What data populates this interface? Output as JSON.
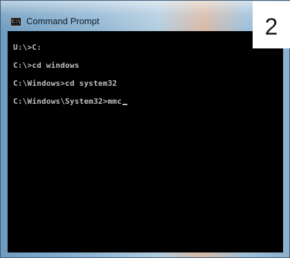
{
  "window": {
    "title": "Command Prompt",
    "icon": "cmd-icon",
    "icon_text": "C:\\"
  },
  "console": {
    "lines": [
      "U:\\>C:",
      "C:\\>cd windows",
      "C:\\Windows>cd system32",
      "C:\\Windows\\System32>mmc"
    ],
    "text_color": "#c0c0c0",
    "background_color": "#000000"
  },
  "step_badge": {
    "number": "2"
  }
}
